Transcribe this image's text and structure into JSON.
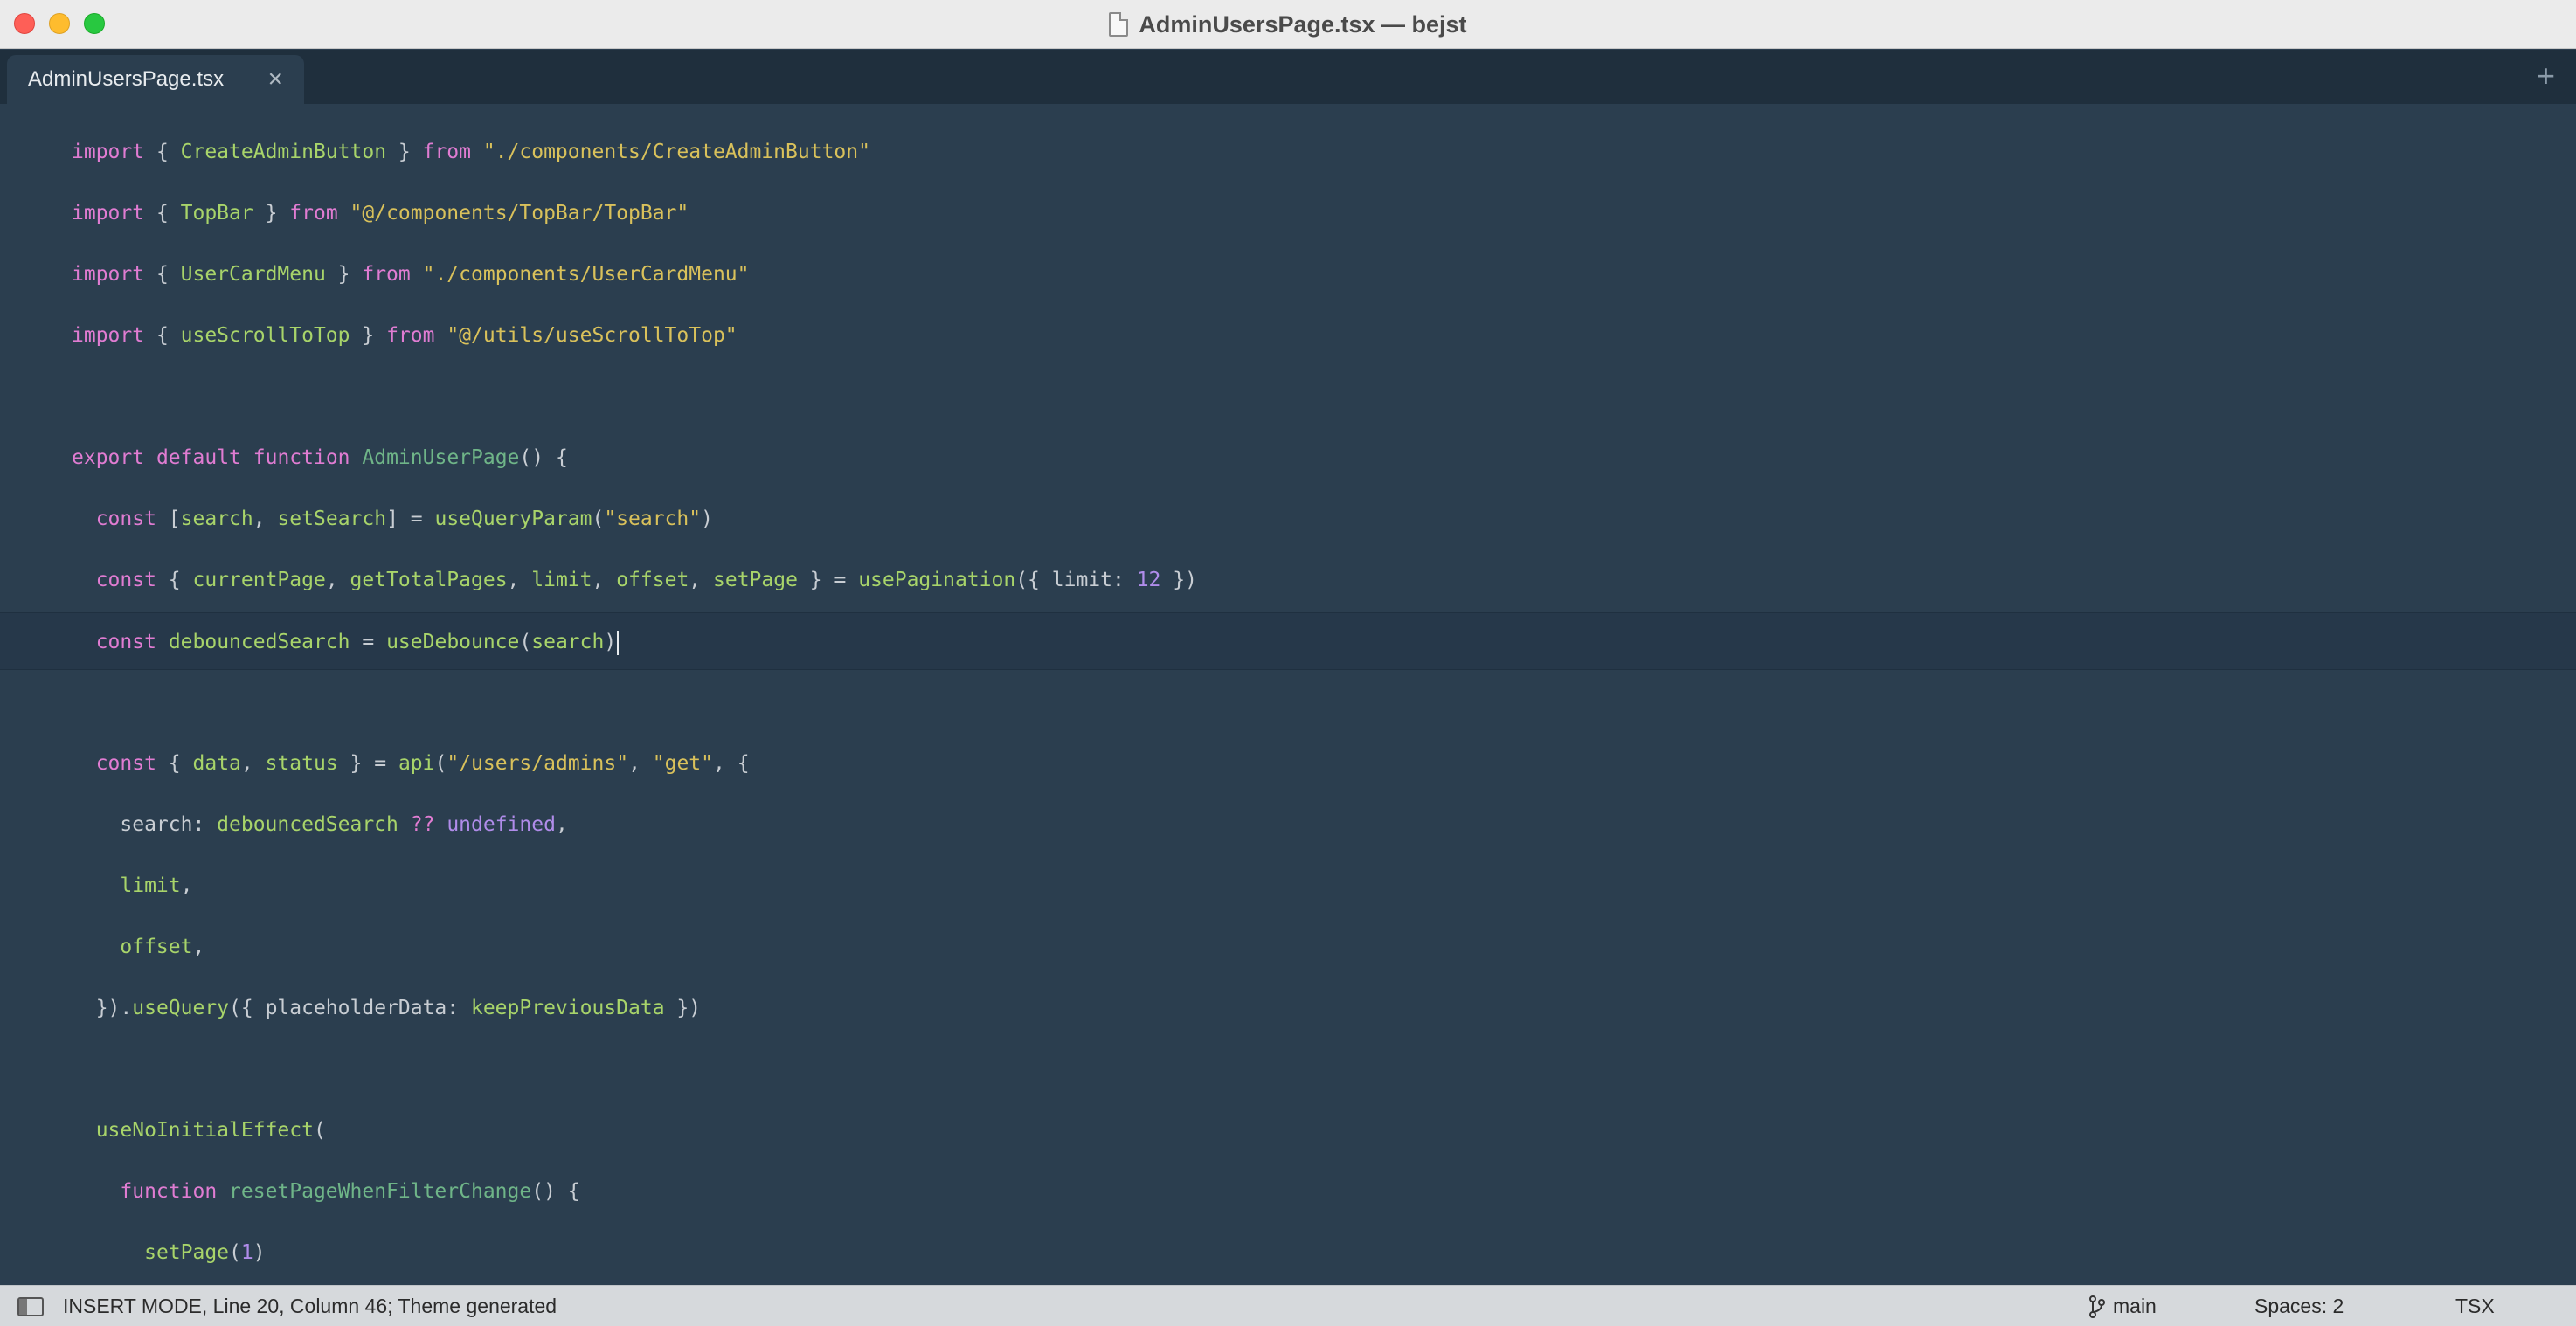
{
  "window": {
    "title": "AdminUsersPage.tsx — bejst"
  },
  "tabs": {
    "active_label": "AdminUsersPage.tsx",
    "close_glyph": "×",
    "add_glyph": "+"
  },
  "editor": {
    "lines": [
      [
        [
          "kw",
          "import"
        ],
        [
          "pl",
          " { "
        ],
        [
          "id",
          "CreateAdminButton"
        ],
        [
          "pl",
          " } "
        ],
        [
          "kw",
          "from"
        ],
        [
          "pl",
          " "
        ],
        [
          "str",
          "\"./components/CreateAdminButton\""
        ]
      ],
      [
        [
          "kw",
          "import"
        ],
        [
          "pl",
          " { "
        ],
        [
          "id",
          "TopBar"
        ],
        [
          "pl",
          " } "
        ],
        [
          "kw",
          "from"
        ],
        [
          "pl",
          " "
        ],
        [
          "str",
          "\"@/components/TopBar/TopBar\""
        ]
      ],
      [
        [
          "kw",
          "import"
        ],
        [
          "pl",
          " { "
        ],
        [
          "id",
          "UserCardMenu"
        ],
        [
          "pl",
          " } "
        ],
        [
          "kw",
          "from"
        ],
        [
          "pl",
          " "
        ],
        [
          "str",
          "\"./components/UserCardMenu\""
        ]
      ],
      [
        [
          "kw",
          "import"
        ],
        [
          "pl",
          " { "
        ],
        [
          "id",
          "useScrollToTop"
        ],
        [
          "pl",
          " } "
        ],
        [
          "kw",
          "from"
        ],
        [
          "pl",
          " "
        ],
        [
          "str",
          "\"@/utils/useScrollToTop\""
        ]
      ],
      [],
      [
        [
          "kw",
          "export"
        ],
        [
          "pl",
          " "
        ],
        [
          "kw",
          "default"
        ],
        [
          "pl",
          " "
        ],
        [
          "kw",
          "function"
        ],
        [
          "pl",
          " "
        ],
        [
          "fn",
          "AdminUserPage"
        ],
        [
          "pl",
          "() {"
        ]
      ],
      [
        [
          "pl",
          "  "
        ],
        [
          "kw",
          "const"
        ],
        [
          "pl",
          " ["
        ],
        [
          "id",
          "search"
        ],
        [
          "pl",
          ", "
        ],
        [
          "id",
          "setSearch"
        ],
        [
          "pl",
          "] = "
        ],
        [
          "id",
          "useQueryParam"
        ],
        [
          "pl",
          "("
        ],
        [
          "str",
          "\"search\""
        ],
        [
          "pl",
          ")"
        ]
      ],
      [
        [
          "pl",
          "  "
        ],
        [
          "kw",
          "const"
        ],
        [
          "pl",
          " { "
        ],
        [
          "id",
          "currentPage"
        ],
        [
          "pl",
          ", "
        ],
        [
          "id",
          "getTotalPages"
        ],
        [
          "pl",
          ", "
        ],
        [
          "id",
          "limit"
        ],
        [
          "pl",
          ", "
        ],
        [
          "id",
          "offset"
        ],
        [
          "pl",
          ", "
        ],
        [
          "id",
          "setPage"
        ],
        [
          "pl",
          " } = "
        ],
        [
          "id",
          "usePagination"
        ],
        [
          "pl",
          "({ limit: "
        ],
        [
          "num",
          "12"
        ],
        [
          "pl",
          " })"
        ]
      ],
      [
        [
          "pl",
          "  "
        ],
        [
          "kw",
          "const"
        ],
        [
          "pl",
          " "
        ],
        [
          "id",
          "debouncedSearch"
        ],
        [
          "pl",
          " = "
        ],
        [
          "id",
          "useDebounce"
        ],
        [
          "pl",
          "("
        ],
        [
          "id",
          "search"
        ],
        [
          "pl",
          ")"
        ]
      ],
      [],
      [
        [
          "pl",
          "  "
        ],
        [
          "kw",
          "const"
        ],
        [
          "pl",
          " { "
        ],
        [
          "id",
          "data"
        ],
        [
          "pl",
          ", "
        ],
        [
          "id",
          "status"
        ],
        [
          "pl",
          " } = "
        ],
        [
          "id",
          "api"
        ],
        [
          "pl",
          "("
        ],
        [
          "str",
          "\"/users/admins\""
        ],
        [
          "pl",
          ", "
        ],
        [
          "str",
          "\"get\""
        ],
        [
          "pl",
          ", {"
        ]
      ],
      [
        [
          "pl",
          "    search: "
        ],
        [
          "id",
          "debouncedSearch"
        ],
        [
          "pl",
          " "
        ],
        [
          "kw",
          "??"
        ],
        [
          "pl",
          " "
        ],
        [
          "num",
          "undefined"
        ],
        [
          "pl",
          ","
        ]
      ],
      [
        [
          "pl",
          "    "
        ],
        [
          "id",
          "limit"
        ],
        [
          "pl",
          ","
        ]
      ],
      [
        [
          "pl",
          "    "
        ],
        [
          "id",
          "offset"
        ],
        [
          "pl",
          ","
        ]
      ],
      [
        [
          "pl",
          "  })."
        ],
        [
          "id",
          "useQuery"
        ],
        [
          "pl",
          "({ placeholderData: "
        ],
        [
          "id",
          "keepPreviousData"
        ],
        [
          "pl",
          " })"
        ]
      ],
      [],
      [
        [
          "pl",
          "  "
        ],
        [
          "id",
          "useNoInitialEffect"
        ],
        [
          "pl",
          "("
        ]
      ],
      [
        [
          "pl",
          "    "
        ],
        [
          "kw",
          "function"
        ],
        [
          "pl",
          " "
        ],
        [
          "fn",
          "resetPageWhenFilterChange"
        ],
        [
          "pl",
          "() {"
        ]
      ],
      [
        [
          "pl",
          "      "
        ],
        [
          "id",
          "setPage"
        ],
        [
          "pl",
          "("
        ],
        [
          "num",
          "1"
        ],
        [
          "pl",
          ")"
        ]
      ],
      [
        [
          "pl",
          "    },"
        ]
      ]
    ]
  },
  "statusbar": {
    "mode_text": "INSERT MODE, Line 20, Column 46; Theme generated",
    "branch": "main",
    "indent": "Spaces: 2",
    "syntax": "TSX"
  },
  "colors": {
    "keyword": "#e07cd2",
    "string": "#d9c15b",
    "identifier": "#a8d46a",
    "function_name": "#6fb588",
    "number": "#b08cea",
    "plain": "#c8cdd3",
    "background": "#2b3e4f"
  }
}
